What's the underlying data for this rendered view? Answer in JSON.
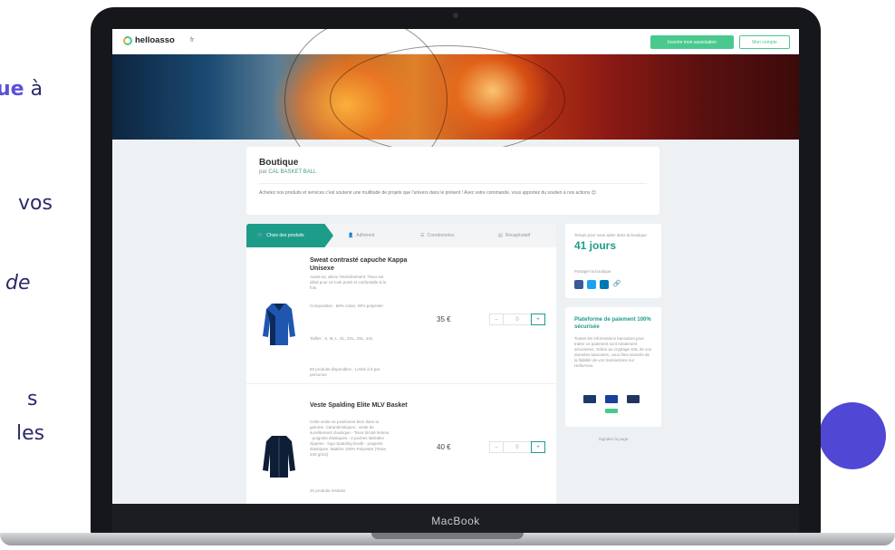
{
  "side_text": {
    "line1_bold": "ue",
    "line1_rest": " à",
    "line2": "vos",
    "line3": "de",
    "line4": "s",
    "line5": "les"
  },
  "laptop": {
    "brand_label": "MacBook"
  },
  "topbar": {
    "logo_text": "helloasso",
    "lang": "fr",
    "register_button": "Inscrire mon association",
    "account_button": "Mon compte"
  },
  "shop": {
    "title": "Boutique",
    "by_prefix": "par ",
    "org_name": "CAL BASKET BALL",
    "description": "Achetez nos produits et services c'est soutenir une multitude de projets que l'univers dans le présent ! Avec votre commande, vous apportez du soutien à nos actions 😊"
  },
  "tabs": [
    {
      "label": "Choix des produits"
    },
    {
      "label": "Adhérent"
    },
    {
      "label": "Coordonnées"
    },
    {
      "label": "Récapitulatif"
    }
  ],
  "products": [
    {
      "title": "Sweat contrasté capuche Kappa Unisexe",
      "text": "Avant-us, demo l'entraînement. Tissu est idéal pour un look porté et confortable à la fois.",
      "composition": "Composition : 68% coton, 20% polyester",
      "sizes": "Tailles : S, M, L, XL, 2XL, 3XL, 4XL",
      "stock_note": "50 produits disponibles - Limité à 5 par personne",
      "price": "35 €",
      "qty": "0"
    },
    {
      "title": "Veste Spalding Elite MLV Basket",
      "text": "Cette veste se positionne bien dans la gamme. Caractéristiques : veste de survêtement classique - Tissu tricoté lenteur - poignets élastiques - 2 poches latérales zippées - logo Spalding brodé - poignets élastiques. Matière 100% Polyester (Texte 240 g/m2)",
      "stock_note": "20 produits restants",
      "price": "40 €",
      "qty": "0"
    }
  ],
  "sidebar": {
    "remaining_label": "Temps pour vous aider dans la boutique",
    "remaining_value": "41 jours",
    "share_label": "Partager la boutique",
    "secure_title": "Plateforme de paiement 100% sécurisée",
    "secure_text": "Toutes les informations bancaires pour traiter ce paiement sont totalement sécurisées. Grâce au cryptage SSL de vos données bancaires, vous êtes assurés de la fiabilité de vos transactions sur HelloAsso.",
    "report_link": "Signaler la page"
  },
  "colors": {
    "accent_green": "#49c98e",
    "teal": "#1e9c8a",
    "purple": "#5047d4"
  }
}
